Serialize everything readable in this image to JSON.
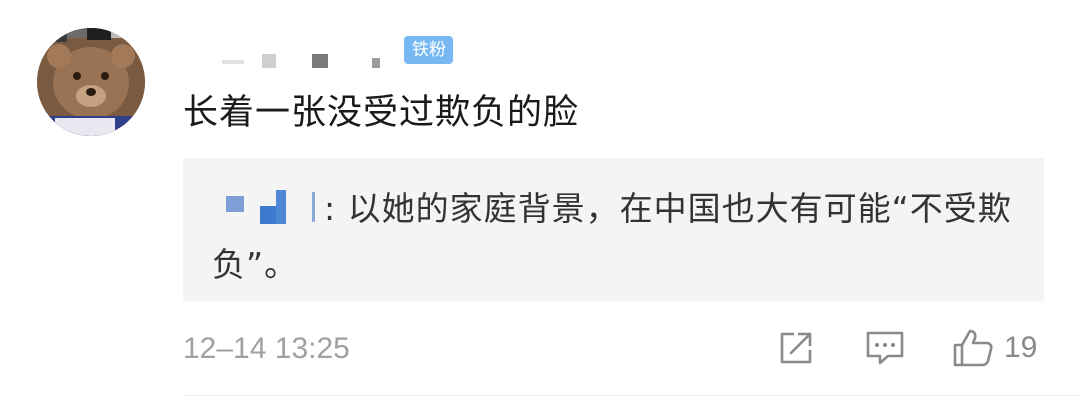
{
  "comment": {
    "badge": "铁粉",
    "text": "长着一张没受过欺负的脸",
    "reply": {
      "text": ": 以她的家庭背景，在中国也大有可能“不受欺负”。"
    },
    "timestamp": "12–14 13:25",
    "actions": {
      "share_icon": "share-icon",
      "reply_icon": "comment-icon",
      "like_icon": "thumbs-up-icon",
      "like_count": "19"
    }
  },
  "colors": {
    "badge_bg": "#78b8f2",
    "text": "#1a1a1a",
    "reply_bg": "#f4f4f4",
    "muted": "#a0a0a0",
    "icon": "#8a8a8a"
  }
}
